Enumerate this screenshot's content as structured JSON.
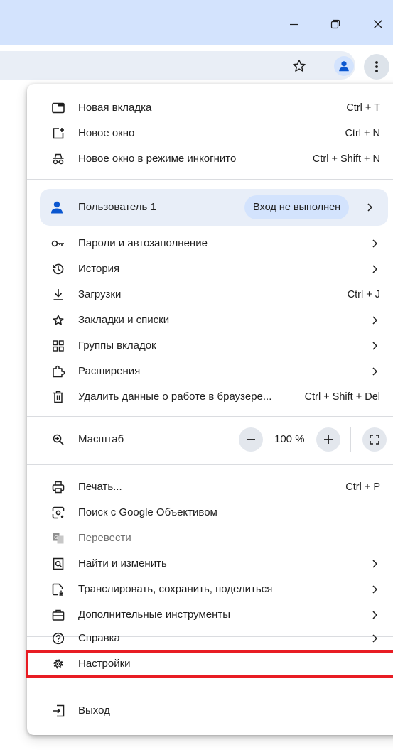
{
  "window": {
    "controls": [
      "minimize",
      "restore",
      "close"
    ],
    "titlebar_color": "#d3e3fd"
  },
  "toolbar": {
    "icons": [
      "bookmark-star-icon",
      "profile-avatar-icon",
      "kebab-menu-icon"
    ]
  },
  "menu": {
    "group1": [
      {
        "label": "Новая вкладка",
        "shortcut": "Ctrl + T",
        "icon": "new-tab-icon"
      },
      {
        "label": "Новое окно",
        "shortcut": "Ctrl + N",
        "icon": "new-window-icon"
      },
      {
        "label": "Новое окно в режиме инкогнито",
        "shortcut": "Ctrl + Shift + N",
        "icon": "incognito-icon"
      }
    ],
    "profile": {
      "name": "Пользователь 1",
      "status": "Вход не выполнен"
    },
    "group2": [
      {
        "label": "Пароли и автозаполнение",
        "icon": "key-icon",
        "submenu": true
      },
      {
        "label": "История",
        "icon": "history-icon",
        "submenu": true
      },
      {
        "label": "Загрузки",
        "shortcut": "Ctrl + J",
        "icon": "download-icon"
      },
      {
        "label": "Закладки и списки",
        "icon": "star-icon",
        "submenu": true
      },
      {
        "label": "Группы вкладок",
        "icon": "tab-groups-icon",
        "submenu": true
      },
      {
        "label": "Расширения",
        "icon": "extension-icon",
        "submenu": true
      },
      {
        "label": "Удалить данные о работе в браузере...",
        "shortcut": "Ctrl + Shift + Del",
        "icon": "trash-icon"
      }
    ],
    "zoom": {
      "label": "Масштаб",
      "value": "100 %",
      "minus": "−",
      "plus": "+"
    },
    "group3": [
      {
        "label": "Печать...",
        "shortcut": "Ctrl + P",
        "icon": "print-icon"
      },
      {
        "label": "Поиск с Google Объективом",
        "icon": "lens-icon"
      },
      {
        "label": "Перевести",
        "icon": "translate-icon",
        "disabled": true
      },
      {
        "label": "Найти и изменить",
        "icon": "find-icon",
        "submenu": true
      },
      {
        "label": "Транслировать, сохранить, поделиться",
        "icon": "cast-icon",
        "submenu": true
      },
      {
        "label": "Дополнительные инструменты",
        "icon": "toolbox-icon",
        "submenu": true
      }
    ],
    "group4": [
      {
        "label": "Справка",
        "icon": "help-icon",
        "submenu": true
      },
      {
        "label": "Настройки",
        "icon": "settings-icon",
        "highlighted": true
      },
      {
        "label": "Выход",
        "icon": "exit-icon"
      }
    ]
  },
  "highlight_color": "#e81c23"
}
